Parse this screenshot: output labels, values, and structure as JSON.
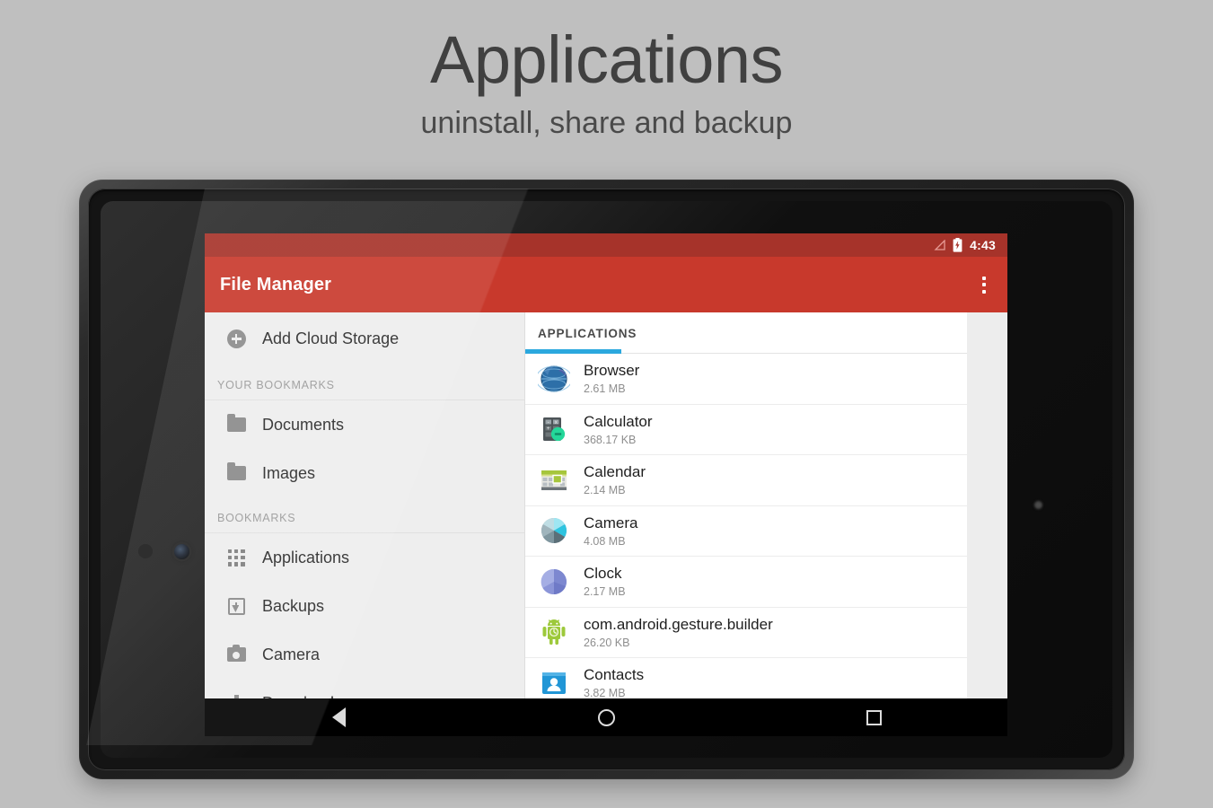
{
  "promo": {
    "title": "Applications",
    "subtitle": "uninstall, share and backup"
  },
  "colors": {
    "page_background": "#bfbfbf",
    "status_bar": "#a6332a",
    "app_bar": "#c8392c",
    "tab_accent": "#2ba8de",
    "sidebar_background": "#eeeeee"
  },
  "status_bar": {
    "time": "4:43",
    "signal_icon": "signal-triangle-icon",
    "battery_icon": "battery-charging-icon"
  },
  "app_bar": {
    "title": "File Manager",
    "overflow_icon": "overflow-menu-icon"
  },
  "sidebar": {
    "add_cloud": {
      "label": "Add Cloud Storage",
      "icon": "plus-circle-icon"
    },
    "sections": [
      {
        "header": "YOUR BOOKMARKS",
        "items": [
          {
            "label": "Documents",
            "icon": "folder-icon"
          },
          {
            "label": "Images",
            "icon": "folder-icon"
          }
        ]
      },
      {
        "header": "BOOKMARKS",
        "items": [
          {
            "label": "Applications",
            "icon": "grid-apps-icon"
          },
          {
            "label": "Backups",
            "icon": "backup-box-icon"
          },
          {
            "label": "Camera",
            "icon": "camera-icon"
          },
          {
            "label": "Download",
            "icon": "download-arrow-icon"
          }
        ]
      }
    ]
  },
  "content": {
    "tabs": [
      {
        "label": "APPLICATIONS",
        "selected": true
      }
    ],
    "apps": [
      {
        "name": "Browser",
        "size": "2.61 MB",
        "icon": "browser-globe-icon"
      },
      {
        "name": "Calculator",
        "size": "368.17 KB",
        "icon": "calculator-icon"
      },
      {
        "name": "Calendar",
        "size": "2.14 MB",
        "icon": "calendar-icon"
      },
      {
        "name": "Camera",
        "size": "4.08 MB",
        "icon": "camera-shutter-icon"
      },
      {
        "name": "Clock",
        "size": "2.17 MB",
        "icon": "clock-sphere-icon"
      },
      {
        "name": "com.android.gesture.builder",
        "size": "26.20 KB",
        "icon": "android-robot-icon"
      },
      {
        "name": "Contacts",
        "size": "3.82 MB",
        "icon": "contacts-person-icon"
      }
    ]
  },
  "navigation_bar": {
    "back": "Back",
    "home": "Home",
    "recents": "Recents"
  }
}
